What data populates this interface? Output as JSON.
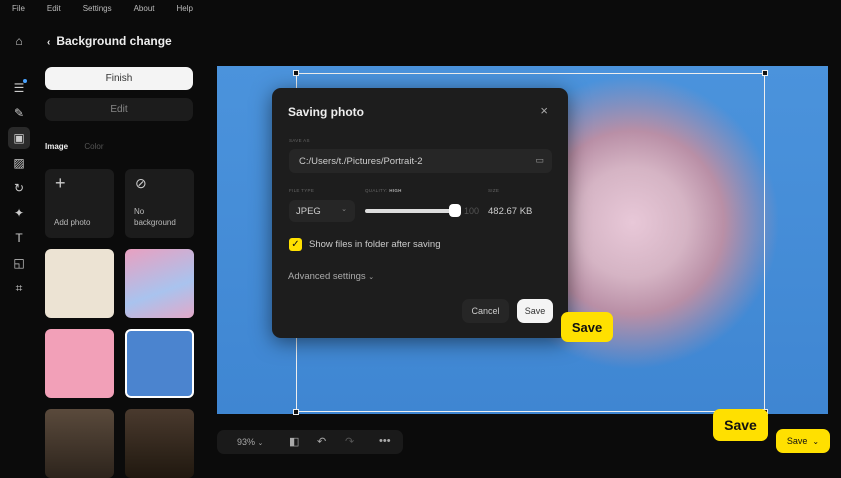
{
  "menu": [
    "File",
    "Edit",
    "Settings",
    "About",
    "Help"
  ],
  "panel": {
    "title": "Background change",
    "finish": "Finish",
    "edit": "Edit",
    "tabs": [
      "Image",
      "Color"
    ],
    "add_photo": "Add photo",
    "no_background": "No background"
  },
  "dialog": {
    "title": "Saving photo",
    "save_as_label": "SAVE AS",
    "path": "C:/Users/t./Pictures/Portrait-2",
    "file_type_label": "FILE TYPE",
    "quality_label": "QUALITY:",
    "quality_value": "HIGH",
    "size_label": "SIZE",
    "file_type": "JPEG",
    "quality": 100,
    "quality_text": "100",
    "size": "482.67 KB",
    "show_files": "Show files in folder after saving",
    "show_files_checked": true,
    "advanced": "Advanced settings",
    "cancel": "Cancel",
    "save": "Save"
  },
  "callouts": {
    "dialog_save": "Save",
    "bottom_save": "Save"
  },
  "toolbar": {
    "zoom": "93%",
    "save": "Save"
  },
  "colors": {
    "accent": "#ffe000",
    "canvas": "#4b93dc"
  }
}
